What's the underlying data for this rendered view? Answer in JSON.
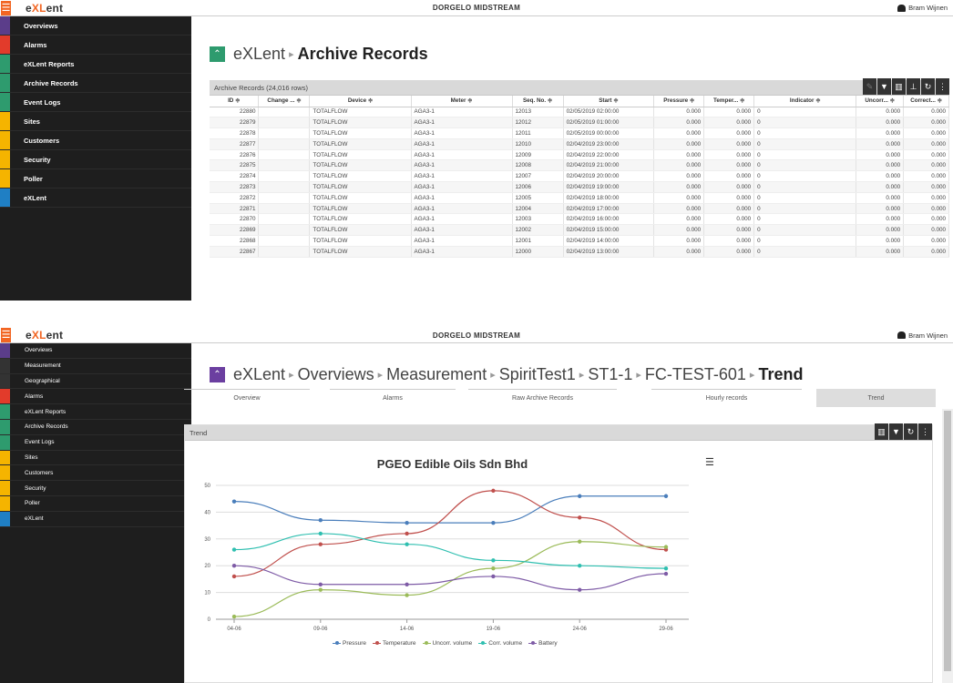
{
  "app": {
    "logo_prefix": "e",
    "logo_x": "XL",
    "logo_suffix": "ent",
    "org_name": "DORGELO MIDSTREAM",
    "user_name": "Bram Wijnen",
    "menu_glyph": "☰"
  },
  "colors": {
    "accent": "#f26522",
    "title_chevron": "#2e9b6e",
    "sidebar_bg": "#1e1e1e"
  },
  "screen1": {
    "sidebar": [
      {
        "label": "Overviews",
        "icon": "grid-icon",
        "color": "#5b3d8a"
      },
      {
        "label": "Alarms",
        "icon": "alarm-icon",
        "color": "#e23b2b"
      },
      {
        "label": "eXLent Reports",
        "icon": "report-icon",
        "color": "#2e9b6e"
      },
      {
        "label": "Archive Records",
        "icon": "archive-icon",
        "color": "#2e9b6e"
      },
      {
        "label": "Event Logs",
        "icon": "log-icon",
        "color": "#2e9b6e"
      },
      {
        "label": "Sites",
        "icon": "sites-icon",
        "color": "#f5b400"
      },
      {
        "label": "Customers",
        "icon": "customers-icon",
        "color": "#f5b400"
      },
      {
        "label": "Security",
        "icon": "lock-icon",
        "color": "#f5b400"
      },
      {
        "label": "Poller",
        "icon": "poller-icon",
        "color": "#f5b400"
      },
      {
        "label": "eXLent",
        "icon": "exlent-icon",
        "color": "#1f7fc4"
      }
    ],
    "title": "eXLent",
    "title_sep": "▸",
    "title_current": "Archive Records",
    "panel_title": "Archive Records (24,016 rows)",
    "tools": [
      "pencil-icon",
      "filter-icon",
      "columns-icon",
      "download-icon",
      "refresh-icon",
      "more-icon"
    ],
    "tool_glyphs": [
      "✎",
      "▼",
      "▥",
      "⊥",
      "↻",
      "⋮"
    ],
    "columns": [
      "ID ≑",
      "Change ... ≑",
      "Device ≑",
      "Meter ≑",
      "Seq. No. ≑",
      "Start ≑",
      "Pressure ≑",
      "Temper... ≑",
      "Indicator ≑",
      "Uncorr... ≑",
      "Correct... ≑"
    ],
    "rows": [
      [
        "22880",
        "",
        "TOTALFLOW",
        "AGA3-1",
        "12013",
        "02/05/2019 02:00:00",
        "0.000",
        "0.000",
        "0",
        "0.000",
        "0.000"
      ],
      [
        "22879",
        "",
        "TOTALFLOW",
        "AGA3-1",
        "12012",
        "02/05/2019 01:00:00",
        "0.000",
        "0.000",
        "0",
        "0.000",
        "0.000"
      ],
      [
        "22878",
        "",
        "TOTALFLOW",
        "AGA3-1",
        "12011",
        "02/05/2019 00:00:00",
        "0.000",
        "0.000",
        "0",
        "0.000",
        "0.000"
      ],
      [
        "22877",
        "",
        "TOTALFLOW",
        "AGA3-1",
        "12010",
        "02/04/2019 23:00:00",
        "0.000",
        "0.000",
        "0",
        "0.000",
        "0.000"
      ],
      [
        "22876",
        "",
        "TOTALFLOW",
        "AGA3-1",
        "12009",
        "02/04/2019 22:00:00",
        "0.000",
        "0.000",
        "0",
        "0.000",
        "0.000"
      ],
      [
        "22875",
        "",
        "TOTALFLOW",
        "AGA3-1",
        "12008",
        "02/04/2019 21:00:00",
        "0.000",
        "0.000",
        "0",
        "0.000",
        "0.000"
      ],
      [
        "22874",
        "",
        "TOTALFLOW",
        "AGA3-1",
        "12007",
        "02/04/2019 20:00:00",
        "0.000",
        "0.000",
        "0",
        "0.000",
        "0.000"
      ],
      [
        "22873",
        "",
        "TOTALFLOW",
        "AGA3-1",
        "12006",
        "02/04/2019 19:00:00",
        "0.000",
        "0.000",
        "0",
        "0.000",
        "0.000"
      ],
      [
        "22872",
        "",
        "TOTALFLOW",
        "AGA3-1",
        "12005",
        "02/04/2019 18:00:00",
        "0.000",
        "0.000",
        "0",
        "0.000",
        "0.000"
      ],
      [
        "22871",
        "",
        "TOTALFLOW",
        "AGA3-1",
        "12004",
        "02/04/2019 17:00:00",
        "0.000",
        "0.000",
        "0",
        "0.000",
        "0.000"
      ],
      [
        "22870",
        "",
        "TOTALFLOW",
        "AGA3-1",
        "12003",
        "02/04/2019 16:00:00",
        "0.000",
        "0.000",
        "0",
        "0.000",
        "0.000"
      ],
      [
        "22869",
        "",
        "TOTALFLOW",
        "AGA3-1",
        "12002",
        "02/04/2019 15:00:00",
        "0.000",
        "0.000",
        "0",
        "0.000",
        "0.000"
      ],
      [
        "22868",
        "",
        "TOTALFLOW",
        "AGA3-1",
        "12001",
        "02/04/2019 14:00:00",
        "0.000",
        "0.000",
        "0",
        "0.000",
        "0.000"
      ],
      [
        "22867",
        "",
        "TOTALFLOW",
        "AGA3-1",
        "12000",
        "02/04/2019 13:00:00",
        "0.000",
        "0.000",
        "0",
        "0.000",
        "0.000"
      ]
    ]
  },
  "screen2": {
    "sidebar": [
      {
        "label": "Overviews",
        "icon": "grid-icon",
        "color": "#5b3d8a"
      },
      {
        "label": "Measurement",
        "icon": "measurement-icon",
        "color": "#333333"
      },
      {
        "label": "Geographical",
        "icon": "geo-icon",
        "color": "#333333"
      },
      {
        "label": "Alarms",
        "icon": "alarm-icon",
        "color": "#e23b2b"
      },
      {
        "label": "eXLent Reports",
        "icon": "report-icon",
        "color": "#2e9b6e"
      },
      {
        "label": "Archive Records",
        "icon": "archive-icon",
        "color": "#2e9b6e"
      },
      {
        "label": "Event Logs",
        "icon": "log-icon",
        "color": "#2e9b6e"
      },
      {
        "label": "Sites",
        "icon": "sites-icon",
        "color": "#f5b400"
      },
      {
        "label": "Customers",
        "icon": "customers-icon",
        "color": "#f5b400"
      },
      {
        "label": "Security",
        "icon": "lock-icon",
        "color": "#f5b400"
      },
      {
        "label": "Poller",
        "icon": "poller-icon",
        "color": "#f5b400"
      },
      {
        "label": "eXLent",
        "icon": "exlent-icon",
        "color": "#1f7fc4"
      }
    ],
    "breadcrumb": [
      "eXLent",
      "Overviews",
      "Measurement",
      "SpiritTest1",
      "ST1-1",
      "FC-TEST-601"
    ],
    "breadcrumb_current": "Trend",
    "tabs": [
      "Overview",
      "Alarms",
      "Raw Archive Records",
      "Hourly records",
      "Trend"
    ],
    "panel_title": "Trend",
    "tools": [
      "columns-icon",
      "filter-icon",
      "refresh-icon",
      "more-icon"
    ],
    "tool_glyphs": [
      "▥",
      "▼",
      "↻",
      "⋮"
    ]
  },
  "chart_data": {
    "type": "line",
    "title": "PGEO Edible Oils Sdn Bhd",
    "categories": [
      "04-06",
      "09-06",
      "14-06",
      "19-06",
      "24-06",
      "29-06"
    ],
    "ylim": [
      0,
      50
    ],
    "yticks": [
      "0",
      "10",
      "20",
      "30",
      "40",
      "50"
    ],
    "grid": true,
    "legend_position": "bottom",
    "series": [
      {
        "name": "Pressure",
        "color": "#4a7ebb",
        "values": [
          44,
          37,
          36,
          36,
          46,
          46
        ]
      },
      {
        "name": "Temperature",
        "color": "#c0504d",
        "values": [
          16,
          28,
          32,
          48,
          38,
          26
        ]
      },
      {
        "name": "Uncorr. volume",
        "color": "#9bbb59",
        "values": [
          1,
          11,
          9,
          19,
          29,
          27
        ]
      },
      {
        "name": "Corr. volume",
        "color": "#2fbfb0",
        "values": [
          26,
          32,
          28,
          22,
          20,
          19
        ]
      },
      {
        "name": "Battery",
        "color": "#7e5ba6",
        "values": [
          20,
          13,
          13,
          16,
          11,
          17
        ]
      }
    ]
  }
}
